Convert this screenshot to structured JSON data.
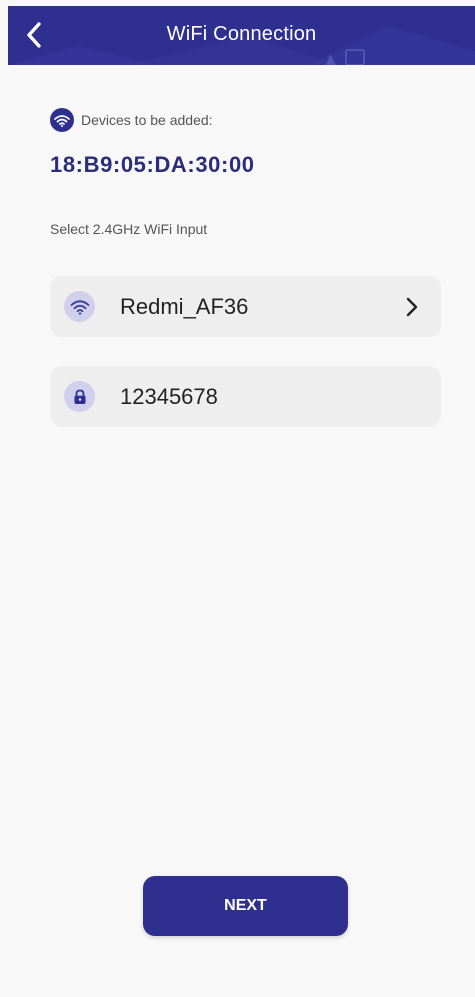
{
  "header": {
    "title": "WiFi Connection",
    "back_icon": "chevron-left-icon"
  },
  "device": {
    "label": "Devices to be added:",
    "icon": "wifi-icon",
    "mac_address": "18:B9:05:DA:30:00"
  },
  "wifi": {
    "hint": "Select 2.4GHz WiFi Input",
    "ssid": "Redmi_AF36",
    "ssid_icon": "wifi-icon",
    "chevron_icon": "chevron-right-icon",
    "password": "12345678",
    "password_icon": "lock-icon"
  },
  "actions": {
    "next_label": "NEXT"
  },
  "colors": {
    "brand": "#2e2f8f",
    "mac_text": "#2b2d7c",
    "field_background": "#eeeeee",
    "icon_circle": "#d0d0ec"
  }
}
